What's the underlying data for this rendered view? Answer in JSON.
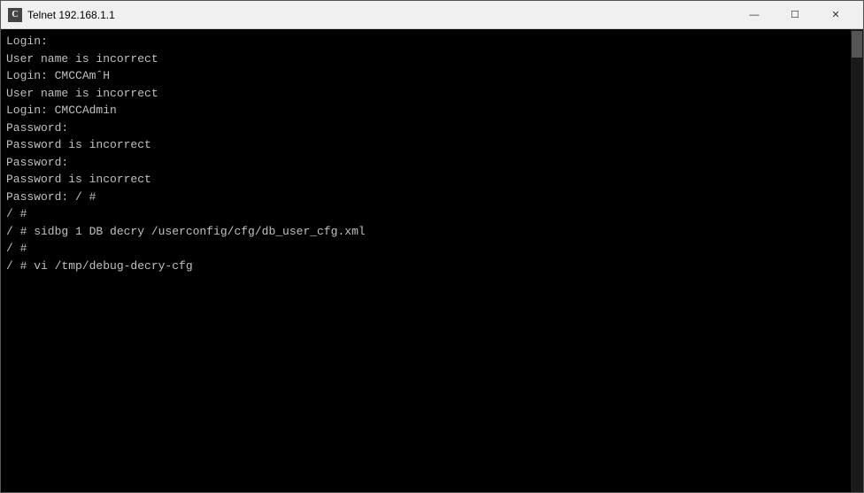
{
  "titleBar": {
    "icon": "C",
    "title": "Telnet 192.168.1.1",
    "minimizeLabel": "—",
    "maximizeLabel": "☐",
    "closeLabel": "✕"
  },
  "terminal": {
    "lines": [
      "Login: ",
      "User name is incorrect",
      "Login: CMCCAmˆH",
      "User name is incorrect",
      "Login: CMCCAdmin",
      "Password:",
      "Password is incorrect",
      "Password:",
      "Password is incorrect",
      "Password: / #",
      "/ #",
      "/ # sidbg 1 DB decry /userconfig/cfg/db_user_cfg.xml",
      "/ #",
      "/ # vi /tmp/debug-decry-cfg"
    ]
  }
}
